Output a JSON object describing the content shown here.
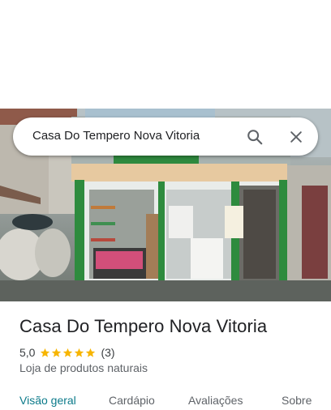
{
  "search": {
    "query": "Casa Do Tempero Nova Vitoria",
    "search_icon": "search-icon",
    "close_icon": "close-icon"
  },
  "photo": {
    "subject": "storefront-photo",
    "storefront_color": "#2e8b3e"
  },
  "place": {
    "name": "Casa Do Tempero Nova Vitoria",
    "rating": "5,0",
    "stars": 5,
    "reviews": "(3)",
    "category": "Loja de produtos naturais"
  },
  "tabs": [
    {
      "label": "Visão geral",
      "active": true
    },
    {
      "label": "Cardápio",
      "active": false
    },
    {
      "label": "Avaliações",
      "active": false
    },
    {
      "label": "Sobre",
      "active": false
    }
  ],
  "colors": {
    "accent": "#0b7a8a",
    "star": "#f7b500",
    "text": "#202124",
    "muted": "#5f6368"
  }
}
